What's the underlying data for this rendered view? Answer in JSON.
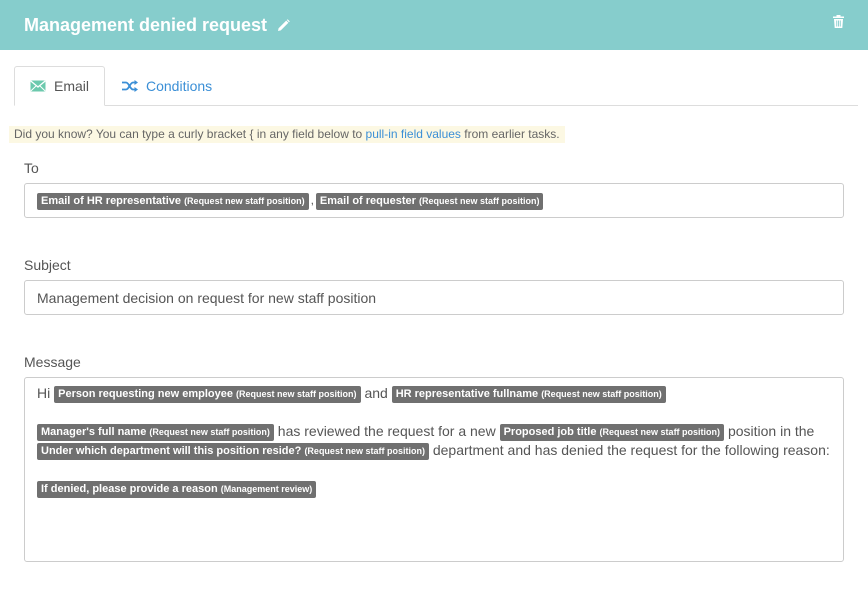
{
  "header": {
    "title": "Management denied request",
    "edit_icon": "pencil-icon",
    "delete_icon": "trash-icon"
  },
  "tabs": [
    {
      "label": "Email",
      "icon": "envelope-icon",
      "active": true
    },
    {
      "label": "Conditions",
      "icon": "shuffle-icon",
      "active": false
    }
  ],
  "tip": {
    "before": "Did you know? You can type a curly bracket { in any field below to ",
    "link": "pull-in field values",
    "after": " from earlier tasks."
  },
  "to": {
    "label": "To",
    "tokens": [
      {
        "field": "Email of HR representative",
        "source": "(Request new staff position)"
      },
      {
        "field": "Email of requester",
        "source": "(Request new staff position)"
      }
    ],
    "separator": ","
  },
  "subject": {
    "label": "Subject",
    "value": "Management decision on request for new staff position"
  },
  "message": {
    "label": "Message",
    "hi": "Hi",
    "token1": {
      "field": "Person requesting new employee",
      "source": "(Request new staff position)"
    },
    "and": "and",
    "token2": {
      "field": "HR representative fullname",
      "source": "(Request new staff position)"
    },
    "token3": {
      "field": "Manager's full name",
      "source": "(Request new staff position)"
    },
    "text1": "has reviewed the request for a new",
    "token4": {
      "field": "Proposed job title",
      "source": "(Request new staff position)"
    },
    "text2": "position in the",
    "token5": {
      "field": "Under which department will this position reside?",
      "source": "(Request new staff position)"
    },
    "text3": "department and has denied the request for the following reason:",
    "token6": {
      "field": "If denied, please provide a reason",
      "source": "(Management review)"
    }
  },
  "colors": {
    "header_bg": "#86cdcc",
    "link": "#3b8fd6",
    "pill_bg": "#707070",
    "tip_bg": "#fcf8e3"
  }
}
